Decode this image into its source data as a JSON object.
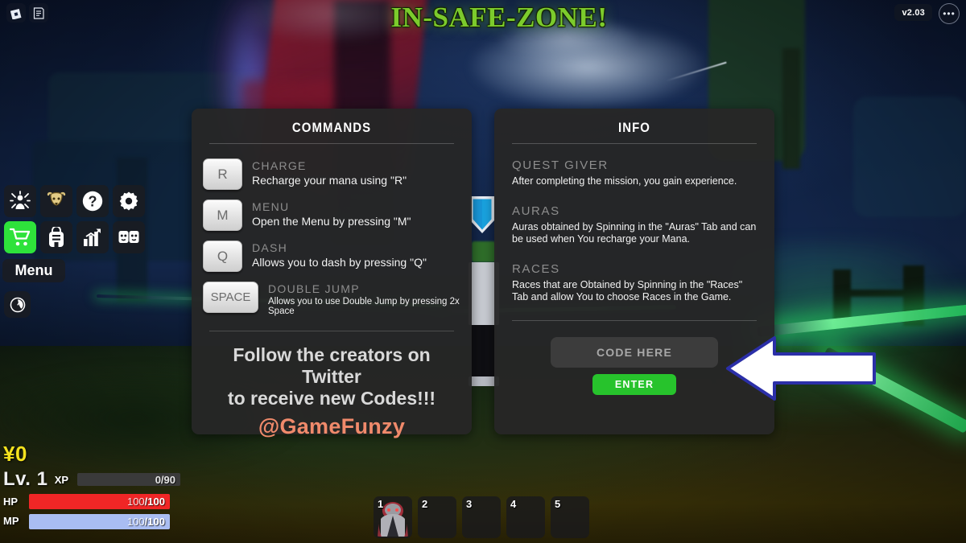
{
  "topbar": {
    "roblox_icon": "roblox-logo-icon",
    "chat_icon": "chat-icon",
    "version": "v2.03",
    "more_label": "•••"
  },
  "zone_title": "IN-SAFE-ZONE!",
  "left_menu": {
    "icons": [
      {
        "name": "character-icon",
        "label": "Character"
      },
      {
        "name": "guild-bull-icon",
        "label": "Guild"
      },
      {
        "name": "help-icon",
        "label": "Help"
      },
      {
        "name": "settings-gear-icon",
        "label": "Settings"
      },
      {
        "name": "shop-cart-icon",
        "label": "Shop"
      },
      {
        "name": "backpack-icon",
        "label": "Inventory"
      },
      {
        "name": "stats-chart-icon",
        "label": "Stats"
      },
      {
        "name": "friends-icon",
        "label": "Friends"
      }
    ],
    "menu_label": "Menu",
    "clock_icon": "clock-icon"
  },
  "commands_panel": {
    "title": "COMMANDS",
    "rows": [
      {
        "key": "R",
        "title": "CHARGE",
        "desc": "Recharge your mana using \"R\""
      },
      {
        "key": "M",
        "title": "MENU",
        "desc": "Open the Menu by pressing \"M\""
      },
      {
        "key": "Q",
        "title": "DASH",
        "desc": "Allows you to dash by pressing \"Q\""
      },
      {
        "key": "SPACE",
        "title": "DOUBLE  JUMP",
        "desc": "Allows you to use Double Jump by pressing 2x Space"
      }
    ],
    "twitter_line1": "Follow the creators on Twitter",
    "twitter_line2": "to receive new Codes!!!",
    "twitter_handle": "@GameFunzy"
  },
  "info_panel": {
    "title": "INFO",
    "sections": [
      {
        "head": "QUEST GIVER",
        "text": "After completing the mission, you gain experience."
      },
      {
        "head": "AURAS",
        "text": "Auras obtained by Spinning in the \"Auras\" Tab and can be used when You recharge your Mana."
      },
      {
        "head": "RACES",
        "text": "Races that are Obtained by Spinning in the \"Races\" Tab and allow You to choose Races in the Game."
      }
    ],
    "code_placeholder": "CODE HERE",
    "enter_label": "ENTER"
  },
  "annotation": {
    "arrow": "left-pointing-arrow",
    "fill_color": "#ffffff",
    "outline_color": "#2b2fa8"
  },
  "hud": {
    "currency": "¥0",
    "level": "Lv. 1",
    "xp_label": "XP",
    "xp_value": "0/90",
    "hp_label": "HP",
    "hp_current": "100",
    "hp_max": "100",
    "mp_label": "MP",
    "mp_current": "100",
    "mp_max": "100",
    "hp_color": "#f02626",
    "mp_color": "#a9bdf2",
    "currency_color": "#f4e21e"
  },
  "hotbar": {
    "slots": [
      {
        "num": "1",
        "filled": true
      },
      {
        "num": "2",
        "filled": false
      },
      {
        "num": "3",
        "filled": false
      },
      {
        "num": "4",
        "filled": false
      },
      {
        "num": "5",
        "filled": false
      }
    ]
  }
}
